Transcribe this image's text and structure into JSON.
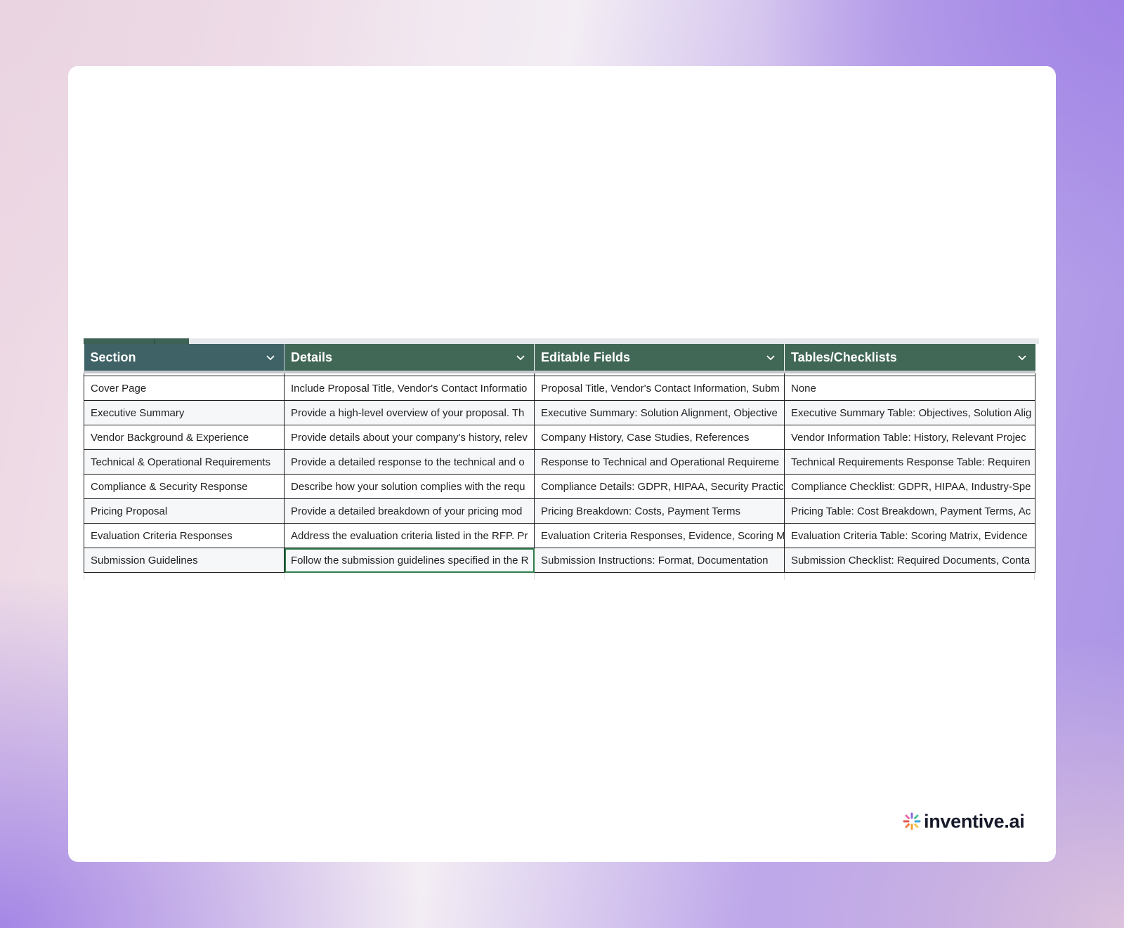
{
  "table": {
    "headers": [
      "Section",
      "Details",
      "Editable Fields",
      "Tables/Checklists"
    ],
    "rows": [
      [
        "Cover Page",
        "Include Proposal Title, Vendor's Contact Informatio",
        "Proposal Title, Vendor's Contact Information, Subm",
        "None"
      ],
      [
        "Executive Summary",
        "Provide a high-level overview of your proposal. Th",
        "Executive Summary: Solution Alignment, Objective",
        "Executive Summary Table: Objectives, Solution Alig"
      ],
      [
        "Vendor Background & Experience",
        "Provide details about your company's history, relev",
        "Company History, Case Studies, References",
        "Vendor Information Table: History, Relevant Projec"
      ],
      [
        "Technical & Operational Requirements",
        "Provide a detailed response to the technical and o",
        "Response to Technical and Operational Requireme",
        "Technical Requirements Response Table: Requiren"
      ],
      [
        "Compliance & Security Response",
        "Describe how your solution complies with the requ",
        "Compliance Details: GDPR, HIPAA, Security Practic",
        "Compliance Checklist: GDPR, HIPAA, Industry-Spe"
      ],
      [
        "Pricing Proposal",
        "Provide a detailed breakdown of your pricing mod",
        "Pricing Breakdown: Costs, Payment Terms",
        "Pricing Table: Cost Breakdown, Payment Terms, Ac"
      ],
      [
        "Evaluation Criteria Responses",
        "Address the evaluation criteria listed in the RFP. Pr",
        "Evaluation Criteria Responses, Evidence, Scoring M",
        "Evaluation Criteria Table: Scoring Matrix, Evidence"
      ],
      [
        "Submission Guidelines",
        "Follow the submission guidelines specified in the R",
        "Submission Instructions: Format, Documentation",
        "Submission Checklist: Required Documents, Conta"
      ]
    ],
    "selected_cell": {
      "row": 7,
      "col": 1
    }
  },
  "brand": {
    "name": "inventive.ai",
    "icon": "sparkle-logo-icon"
  },
  "colors": {
    "header_bg": "#416757",
    "header_first_bg": "#3e6265",
    "selection": "#2e7d4a"
  }
}
